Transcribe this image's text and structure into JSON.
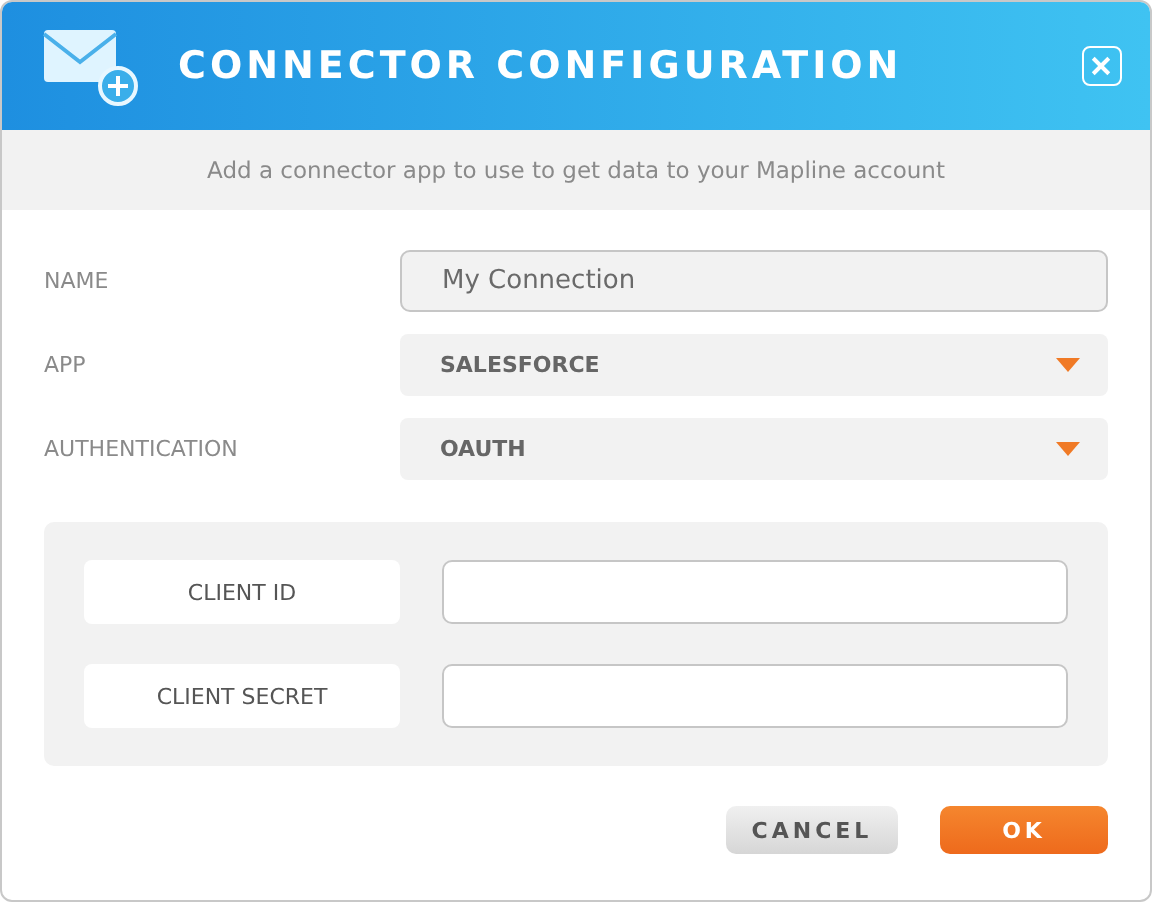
{
  "window": {
    "title": "CONNECTOR CONFIGURATION"
  },
  "subtitle": "Add a connector app to use to get data to your Mapline account",
  "fields": [
    {
      "label": "NAME",
      "kind": "text",
      "value": "My Connection"
    },
    {
      "label": "APP",
      "kind": "select",
      "value": "SALESFORCE"
    },
    {
      "label": "AUTHENTICATION",
      "kind": "select",
      "value": "OAUTH"
    }
  ],
  "credentials": [
    {
      "label": "CLIENT ID"
    },
    {
      "label": "CLIENT SECRET"
    }
  ],
  "buttons": [
    {
      "label": "CANCEL",
      "kind": "secondary"
    },
    {
      "label": "OK",
      "kind": "primary"
    }
  ]
}
